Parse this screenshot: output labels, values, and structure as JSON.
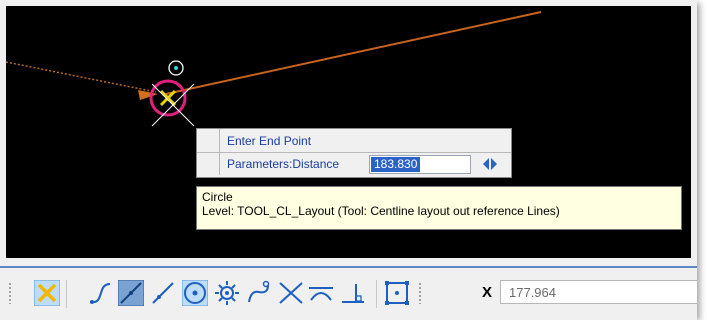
{
  "accuSnap": {
    "prompt_title": "Enter End Point",
    "param_label": "Parameters:Distance",
    "param_value": "183.830"
  },
  "tooltip": {
    "element_type": "Circle",
    "level_info": "Level: TOOL_CL_Layout (Tool: Centline layout out reference Lines)"
  },
  "snap_toolbar": {
    "buttons": [
      {
        "name": "keypoint-snap-icon",
        "active": true
      },
      {
        "name": "nearest-snap-icon",
        "active": false
      },
      {
        "name": "midpoint-snap-icon",
        "active": false
      },
      {
        "name": "perpendicular-line-snap-icon",
        "active": false
      },
      {
        "name": "center-snap-icon",
        "active": true
      },
      {
        "name": "origin-snap-icon",
        "active": false
      },
      {
        "name": "tangent-snap-icon",
        "active": false
      },
      {
        "name": "intersection-snap-icon",
        "active": false
      },
      {
        "name": "tangent-point-snap-icon",
        "active": false
      },
      {
        "name": "perpendicular-snap-icon",
        "active": false
      },
      {
        "name": "bisector-snap-icon",
        "active": false
      }
    ],
    "x_label": "X",
    "x_value": "177.964"
  },
  "colors": {
    "view_background": "#000000",
    "line_color": "#c8641e",
    "circle_color": "#e0207a",
    "snap_cross_color": "#e8d400",
    "toolbar_accent": "#5f86c5",
    "selection_highlight": "#2b62c8"
  }
}
